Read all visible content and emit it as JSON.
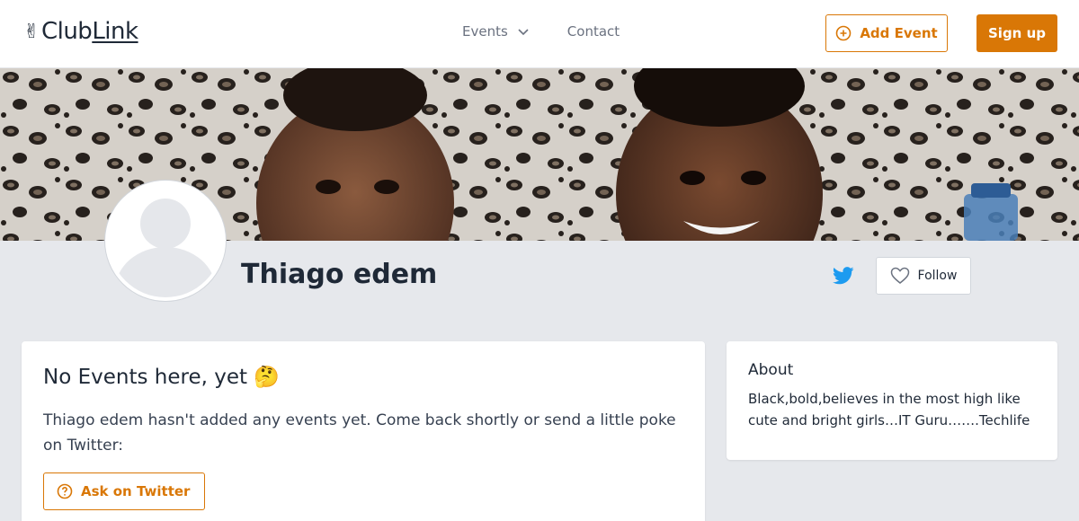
{
  "header": {
    "logo": {
      "emoji": "✌",
      "club": "Club",
      "link": "Link"
    },
    "nav": {
      "events_label": "Events",
      "contact_label": "Contact"
    },
    "add_event_label": "Add Event",
    "signup_label": "Sign up"
  },
  "profile": {
    "name": "Thiago edem",
    "follow_label": "Follow"
  },
  "events_card": {
    "title": "No Events here, yet 🤔",
    "message": "Thiago edem hasn't added any events yet. Come back shortly or send a little poke on Twitter:",
    "ask_label": "Ask on Twitter"
  },
  "about_card": {
    "title": "About",
    "text": "Black,bold,believes in the most high like cute and bright girls…IT Guru…….Techlife"
  },
  "colors": {
    "accent": "#d97706",
    "twitter": "#1d9bf0",
    "page_bg": "#e6e8ec"
  },
  "icons": [
    "chevron-down-icon",
    "plus-circle-icon",
    "twitter-icon",
    "heart-icon",
    "question-circle-icon",
    "avatar-placeholder-icon"
  ]
}
